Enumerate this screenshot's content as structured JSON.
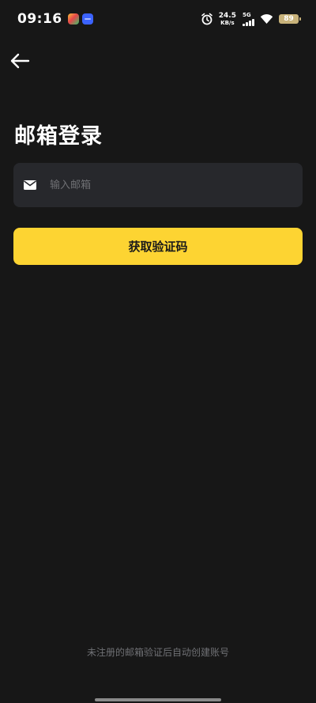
{
  "status_bar": {
    "time": "09:16",
    "net_speed_value": "24.5",
    "net_speed_unit": "KB/s",
    "network_type": "5G",
    "battery": "89",
    "icons": [
      "app-icon",
      "app-icon",
      "alarm-icon",
      "signal-icon",
      "wifi-icon",
      "battery-icon"
    ]
  },
  "header": {
    "back_icon": "arrow-left-icon"
  },
  "main": {
    "title": "邮箱登录",
    "email_field": {
      "icon": "mail-icon",
      "placeholder": "输入邮箱",
      "value": ""
    },
    "submit_label": "获取验证码"
  },
  "footer": {
    "note": "未注册的邮箱验证后自动创建账号"
  },
  "colors": {
    "background": "#171717",
    "field_background": "#27282c",
    "accent": "#fdd432",
    "muted_text": "#6f7074"
  }
}
